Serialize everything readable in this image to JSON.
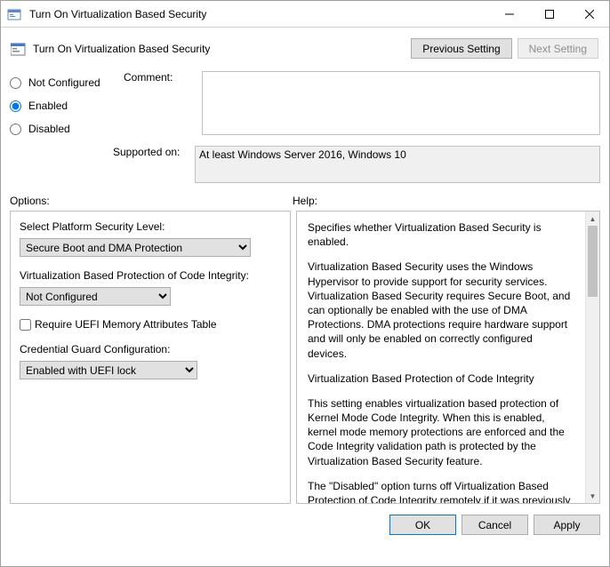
{
  "window": {
    "title": "Turn On Virtualization Based Security"
  },
  "header": {
    "policy_title": "Turn On Virtualization Based Security",
    "prev_btn": "Previous Setting",
    "next_btn": "Next Setting"
  },
  "state": {
    "not_configured": "Not Configured",
    "enabled": "Enabled",
    "disabled": "Disabled",
    "selected": "enabled"
  },
  "comment": {
    "label": "Comment:",
    "value": ""
  },
  "supported": {
    "label": "Supported on:",
    "value": "At least Windows Server 2016, Windows 10"
  },
  "section_labels": {
    "options": "Options:",
    "help": "Help:"
  },
  "options": {
    "platform_level": {
      "label": "Select Platform Security Level:",
      "value": "Secure Boot and DMA Protection"
    },
    "vbs_code_integrity": {
      "label": "Virtualization Based Protection of Code Integrity:",
      "value": "Not Configured"
    },
    "uefi_mem_attr": {
      "label": "Require UEFI Memory Attributes Table",
      "checked": false
    },
    "cred_guard": {
      "label": "Credential Guard Configuration:",
      "value": "Enabled with UEFI lock"
    }
  },
  "help": {
    "p1": "Specifies whether Virtualization Based Security is enabled.",
    "p2": "Virtualization Based Security uses the Windows Hypervisor to provide support for security services. Virtualization Based Security requires Secure Boot, and can optionally be enabled with the use of DMA Protections. DMA protections require hardware support and will only be enabled on correctly configured devices.",
    "p3": "Virtualization Based Protection of Code Integrity",
    "p4": "This setting enables virtualization based protection of Kernel Mode Code Integrity. When this is enabled, kernel mode memory protections are enforced and the Code Integrity validation path is protected by the Virtualization Based Security feature.",
    "p5": "The \"Disabled\" option turns off Virtualization Based Protection of Code Integrity remotely if it was previously turned on with the \"Enabled without lock\" option."
  },
  "buttons": {
    "ok": "OK",
    "cancel": "Cancel",
    "apply": "Apply"
  }
}
